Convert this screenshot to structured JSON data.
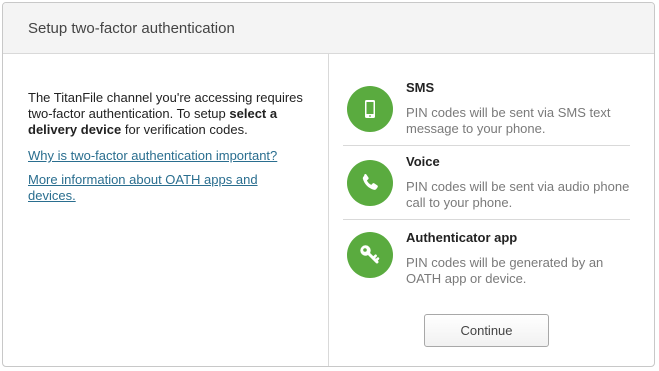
{
  "dialog": {
    "title": "Setup two-factor authentication"
  },
  "intro": {
    "text_before": "The TitanFile channel you're accessing requires two-factor authentication. To setup ",
    "text_bold": "select a delivery device",
    "text_after": " for verification codes."
  },
  "links": {
    "why_important": "Why is two-factor authentication important?",
    "more_info": "More information about OATH apps and devices."
  },
  "options": [
    {
      "title": "SMS",
      "description": "PIN codes will be sent via SMS text message to your phone.",
      "icon": "mobile-phone-icon"
    },
    {
      "title": "Voice",
      "description": "PIN codes will be sent via audio phone call to your phone.",
      "icon": "phone-handset-icon"
    },
    {
      "title": "Authenticator app",
      "description": "PIN codes will be generated by an OATH app or device.",
      "icon": "key-icon"
    }
  ],
  "actions": {
    "continue_label": "Continue"
  },
  "colors": {
    "icon_green": "#5aab3f",
    "link_blue": "#2a6e8f",
    "header_bg": "#f4f4f4"
  }
}
